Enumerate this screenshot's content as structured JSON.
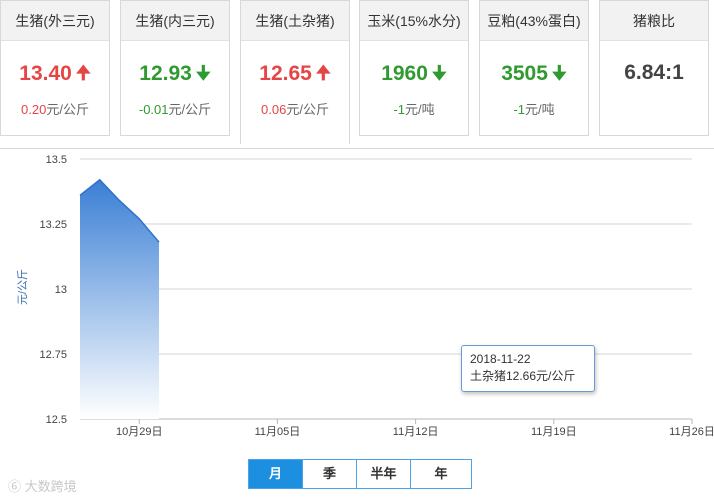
{
  "cards": [
    {
      "title": "生猪(外三元)",
      "price": "13.40",
      "direction": "up",
      "change": "0.20",
      "unit": "元/公斤"
    },
    {
      "title": "生猪(内三元)",
      "price": "12.93",
      "direction": "down",
      "change": "-0.01",
      "unit": "元/公斤"
    },
    {
      "title": "生猪(土杂猪)",
      "price": "12.65",
      "direction": "up",
      "change": "0.06",
      "unit": "元/公斤"
    },
    {
      "title": "玉米(15%水分)",
      "price": "1960",
      "direction": "down",
      "change": "-1",
      "unit": "元/吨"
    },
    {
      "title": "豆粕(43%蛋白)",
      "price": "3505",
      "direction": "down",
      "change": "-1",
      "unit": "元/吨"
    },
    {
      "title": "猪粮比",
      "price": "6.84:1",
      "direction": "flat",
      "change": "",
      "unit": ""
    }
  ],
  "colors": {
    "up": "#e64545",
    "down": "#2f9a2f",
    "area_top": "#3a7fd5",
    "area_bottom": "#ffffff",
    "accent": "#1d8fe1"
  },
  "chart_data": {
    "type": "area",
    "ylabel": "元/公斤",
    "ylim": [
      12.5,
      13.5
    ],
    "yticks": [
      13.5,
      13.25,
      13,
      12.75,
      12.5
    ],
    "ytick_labels": [
      "13.5",
      "13.25",
      "13",
      "12.75",
      "12.5"
    ],
    "xlim": [
      "2018-10-26",
      "2018-11-26"
    ],
    "xticks": [
      "2018-10-29",
      "2018-11-05",
      "2018-11-12",
      "2018-11-19",
      "2018-11-26"
    ],
    "xtick_labels": [
      "10月29日",
      "11月05日",
      "11月12日",
      "11月19日",
      "11月26日"
    ],
    "grid": true,
    "series": [
      {
        "x": [
          "2018-10-26",
          "2018-10-27",
          "2018-10-28",
          "2018-10-29",
          "2018-10-30"
        ],
        "y": [
          13.36,
          13.42,
          13.34,
          13.27,
          13.18
        ]
      }
    ]
  },
  "tooltip": {
    "date": "2018-11-22",
    "text": "土杂猪12.66元/公斤"
  },
  "periods": [
    {
      "label": "月",
      "active": true
    },
    {
      "label": "季",
      "active": false
    },
    {
      "label": "半年",
      "active": false
    },
    {
      "label": "年",
      "active": false
    }
  ],
  "watermark": "大数跨境"
}
